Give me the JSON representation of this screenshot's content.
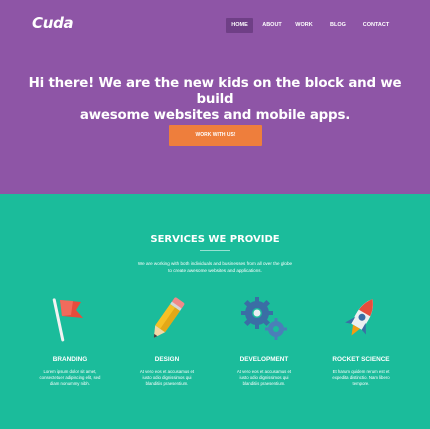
{
  "brand": {
    "logo": "Cuda"
  },
  "nav": {
    "items": [
      {
        "label": "HOME",
        "active": true
      },
      {
        "label": "ABOUT",
        "active": false
      },
      {
        "label": "WORK",
        "active": false
      },
      {
        "label": "BLOG",
        "active": false
      },
      {
        "label": "CONTACT",
        "active": false
      }
    ]
  },
  "hero": {
    "title_line1": "Hi there! We are the new kids on the block and we build",
    "title_line2": "awesome websites and mobile apps.",
    "cta_label": "WORK WITH US!"
  },
  "services": {
    "title": "SERVICES WE PROVIDE",
    "subtitle_line1": "We are working with both individuals and businesses from all over the globe",
    "subtitle_line2": "to create awesome websites and applications.",
    "items": [
      {
        "icon": "flag-icon",
        "name": "BRANDING",
        "desc_line1": "Lorem ipsum dolor sit amet,",
        "desc_line2": "consectetuer adipiscing elit, sed",
        "desc_line3": "diam nonummy nibh."
      },
      {
        "icon": "pencil-icon",
        "name": "DESIGN",
        "desc_line1": "At vero eos et accusamus et",
        "desc_line2": "iusto odio dignissimos qui",
        "desc_line3": "blanditiis praesentium."
      },
      {
        "icon": "gears-icon",
        "name": "DEVELOPMENT",
        "desc_line1": "At vero eos et accusamus et",
        "desc_line2": "iusto odio dignissimos qui",
        "desc_line3": "blanditiis praesentium."
      },
      {
        "icon": "rocket-icon",
        "name": "ROCKET SCIENCE",
        "desc_line1": "Et harum quidem rerum est et",
        "desc_line2": "expedita distinctio. Nam libero",
        "desc_line3": "tempore."
      }
    ]
  },
  "colors": {
    "hero_bg": "#8e55a6",
    "services_bg": "#1bbc9b",
    "accent": "#ee7e3c",
    "nav_active": "#6f3f86"
  }
}
